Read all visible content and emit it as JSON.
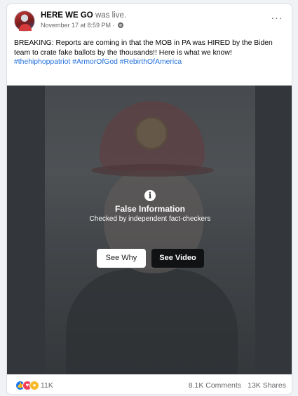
{
  "post": {
    "author": "HERE WE GO",
    "action": " was live.",
    "timestamp": "November 17 at 8:59 PM · ",
    "privacy_icon": "globe-icon",
    "more_icon": "more-options-icon",
    "more_label": "···",
    "text": "BREAKING: Reports are coming in that the MOB in PA was HIRED by the Biden team to crate fake ballots by the thousands!! Here is what we know!",
    "hashtags": [
      "#thehiphoppatriot",
      "#ArmorOfGod",
      "#RebirthOfAmerica"
    ]
  },
  "warning": {
    "icon_label": "i",
    "title": "False Information",
    "subtitle": "Checked by independent fact-checkers",
    "see_why_label": "See Why",
    "see_video_label": "See Video"
  },
  "footer": {
    "reaction_icons": [
      "like-icon",
      "love-icon",
      "wow-icon"
    ],
    "reactions_count": "11K",
    "comments": "8.1K Comments",
    "shares": "13K Shares"
  },
  "colors": {
    "link": "#216fdb",
    "like": "#1877f2",
    "love": "#f33e58",
    "wow": "#f7b928"
  }
}
